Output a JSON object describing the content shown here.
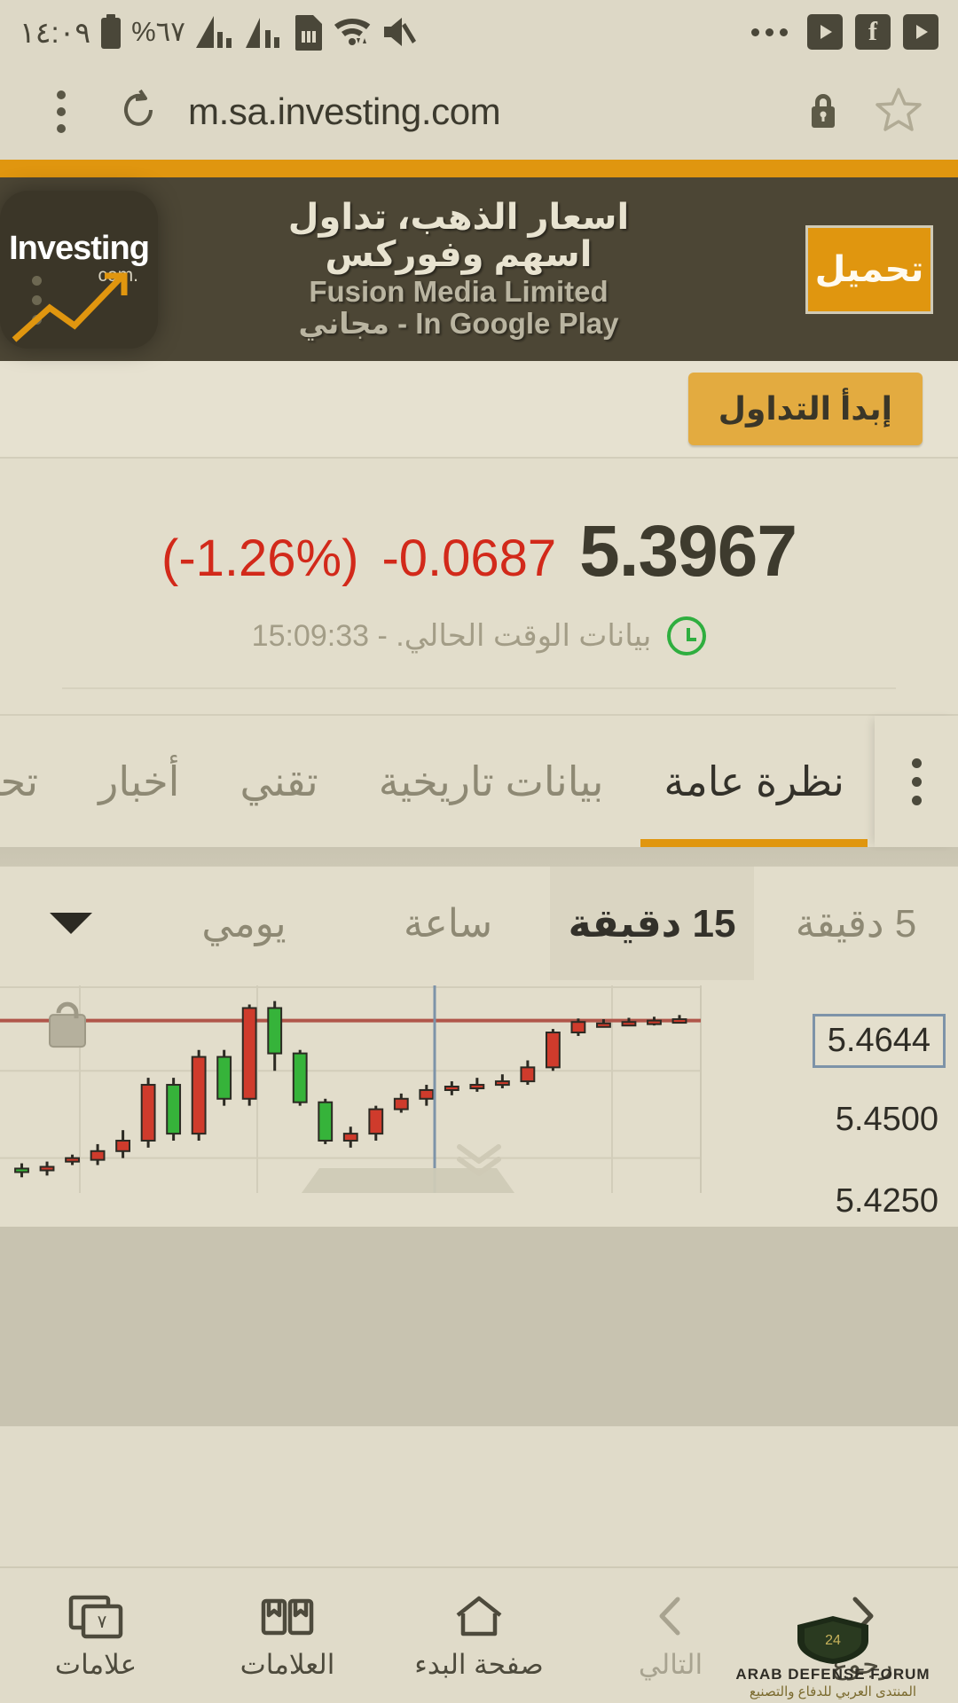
{
  "statusbar": {
    "time": "١٤:٠٩",
    "battery_pct": "%٦٧",
    "icons": [
      "battery-icon",
      "signal-bars-icon",
      "signal-bars-2-icon",
      "sim-card-icon",
      "wifi-icon",
      "mute-icon"
    ],
    "right_icons": [
      "overflow-dots-icon",
      "youtube-icon",
      "facebook-icon",
      "youtube-icon-2"
    ]
  },
  "browser": {
    "url": "m.sa.investing.com",
    "menu_icon": "kebab-menu-icon",
    "reload_icon": "reload-icon",
    "lock_icon": "lock-icon",
    "bookmark_icon": "star-icon"
  },
  "ad": {
    "close_label": "✕",
    "title": "اسعار الذهب، تداول اسهم وفوركس",
    "subtitle": "Fusion Media Limited",
    "subtitle2": "In Google Play - مجاني",
    "button_label": "تحميل",
    "logo_text": "Investing",
    "logo_com": ".com",
    "accent": "#e0960f"
  },
  "cta": {
    "label": "إبدأ التداول"
  },
  "quote": {
    "last": "5.3967",
    "change": "-0.0687",
    "change_pct": "(-1.26%)",
    "change_color": "#d2291a",
    "timestamp_text": "بيانات الوقت الحالي. - 15:09:33",
    "clock_icon": "clock-icon"
  },
  "tabs": {
    "items": [
      {
        "label": "نظرة عامة",
        "active": true
      },
      {
        "label": "بيانات تاريخية",
        "active": false
      },
      {
        "label": "تقني",
        "active": false
      },
      {
        "label": "أخبار",
        "active": false
      },
      {
        "label": "تحا",
        "active": false
      }
    ],
    "overflow_icon": "kebab-menu-icon",
    "active_underline_color": "#e0960f"
  },
  "timeframes": {
    "items": [
      {
        "label": "5 دقيقة",
        "active": false
      },
      {
        "label": "15 دقيقة",
        "active": true
      },
      {
        "label": "ساعة",
        "active": false
      },
      {
        "label": "يومي",
        "active": false
      }
    ],
    "dropdown_icon": "chevron-down-icon"
  },
  "chart_data": {
    "type": "candlestick",
    "title": "",
    "xlabel": "",
    "ylabel": "",
    "ylim": [
      5.415,
      5.476
    ],
    "grid": true,
    "last_price_label": "5.4644",
    "last_price_line_color": "#b0564a",
    "axis_ticks": [
      "5.4644",
      "5.4500",
      "5.4250"
    ],
    "up_color": "#36b33a",
    "down_color": "#cf3b2c",
    "candles": [
      {
        "o": 5.4648,
        "h": 5.466,
        "l": 5.4636,
        "c": 5.4644
      },
      {
        "o": 5.4644,
        "h": 5.4655,
        "l": 5.463,
        "c": 5.464
      },
      {
        "o": 5.464,
        "h": 5.4652,
        "l": 5.4628,
        "c": 5.4636
      },
      {
        "o": 5.4636,
        "h": 5.4648,
        "l": 5.4624,
        "c": 5.4632
      },
      {
        "o": 5.464,
        "h": 5.465,
        "l": 5.46,
        "c": 5.461
      },
      {
        "o": 5.461,
        "h": 5.462,
        "l": 5.45,
        "c": 5.451
      },
      {
        "o": 5.451,
        "h": 5.453,
        "l": 5.446,
        "c": 5.447
      },
      {
        "o": 5.447,
        "h": 5.449,
        "l": 5.445,
        "c": 5.446
      },
      {
        "o": 5.446,
        "h": 5.448,
        "l": 5.444,
        "c": 5.4455
      },
      {
        "o": 5.4455,
        "h": 5.447,
        "l": 5.443,
        "c": 5.4445
      },
      {
        "o": 5.4445,
        "h": 5.446,
        "l": 5.44,
        "c": 5.442
      },
      {
        "o": 5.442,
        "h": 5.4435,
        "l": 5.438,
        "c": 5.439
      },
      {
        "o": 5.439,
        "h": 5.44,
        "l": 5.43,
        "c": 5.432
      },
      {
        "o": 5.432,
        "h": 5.434,
        "l": 5.428,
        "c": 5.43
      },
      {
        "o": 5.43,
        "h": 5.442,
        "l": 5.429,
        "c": 5.441
      },
      {
        "o": 5.441,
        "h": 5.456,
        "l": 5.44,
        "c": 5.455
      },
      {
        "o": 5.455,
        "h": 5.47,
        "l": 5.45,
        "c": 5.468
      },
      {
        "o": 5.468,
        "h": 5.469,
        "l": 5.44,
        "c": 5.442
      },
      {
        "o": 5.442,
        "h": 5.456,
        "l": 5.44,
        "c": 5.454
      },
      {
        "o": 5.454,
        "h": 5.456,
        "l": 5.43,
        "c": 5.432
      },
      {
        "o": 5.432,
        "h": 5.448,
        "l": 5.43,
        "c": 5.446
      },
      {
        "o": 5.446,
        "h": 5.448,
        "l": 5.428,
        "c": 5.43
      },
      {
        "o": 5.43,
        "h": 5.433,
        "l": 5.425,
        "c": 5.427
      },
      {
        "o": 5.427,
        "h": 5.429,
        "l": 5.423,
        "c": 5.4245
      },
      {
        "o": 5.425,
        "h": 5.426,
        "l": 5.423,
        "c": 5.424
      },
      {
        "o": 5.4225,
        "h": 5.424,
        "l": 5.42,
        "c": 5.4215
      },
      {
        "o": 5.4215,
        "h": 5.4235,
        "l": 5.4195,
        "c": 5.422
      }
    ],
    "expand_icon": "chevron-double-down-icon"
  },
  "bottomnav": {
    "items": [
      {
        "label": "رجوع",
        "icon": "chevron-right-icon",
        "dim": false
      },
      {
        "label": "التالي",
        "icon": "chevron-left-icon",
        "dim": true
      },
      {
        "label": "صفحة البدء",
        "icon": "home-icon",
        "dim": false
      },
      {
        "label": "العلامات",
        "icon": "bookmarks-icon",
        "dim": false
      },
      {
        "label": "علامات",
        "icon": "tabs-icon",
        "dim": false
      }
    ],
    "tab_count": "٧"
  },
  "watermark": {
    "line1": "ARAB DEFENSE FORUM",
    "line2": "المنتدى العربي للدفاع والتصنيع"
  }
}
